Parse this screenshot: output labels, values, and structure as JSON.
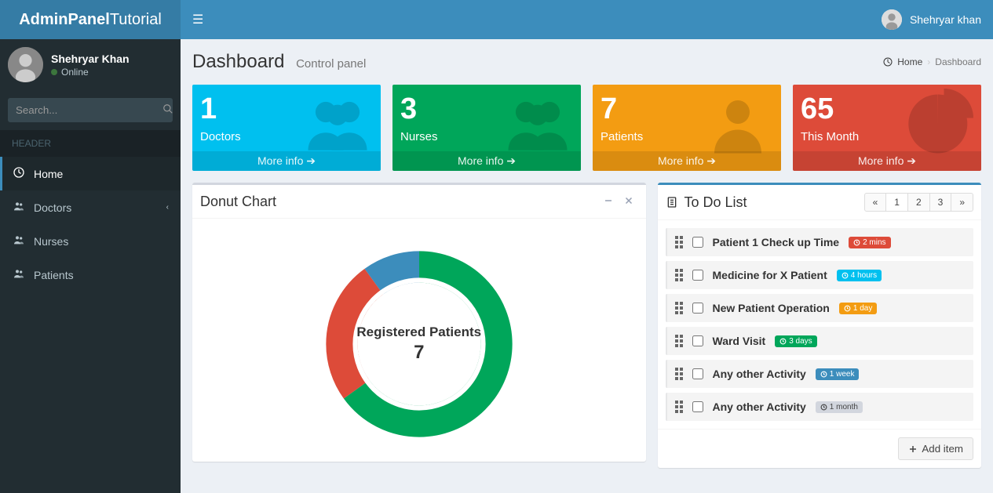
{
  "brand": {
    "bold": "AdminPanel",
    "light": "Tutorial"
  },
  "topbar": {
    "username": "Shehryar khan"
  },
  "sidebar": {
    "user": {
      "name": "Shehryar Khan",
      "status": "Online"
    },
    "search_placeholder": "Search...",
    "header": "HEADER",
    "menu": [
      {
        "label": "Home",
        "icon": "dashboard",
        "active": true
      },
      {
        "label": "Doctors",
        "icon": "users",
        "has_children": true
      },
      {
        "label": "Nurses",
        "icon": "users"
      },
      {
        "label": "Patients",
        "icon": "users"
      }
    ]
  },
  "page": {
    "title": "Dashboard",
    "subtitle": "Control panel",
    "breadcrumb_home": "Home",
    "breadcrumb_current": "Dashboard"
  },
  "stats": [
    {
      "value": "1",
      "label": "Doctors",
      "more": "More info",
      "color": "aqua",
      "icon": "users"
    },
    {
      "value": "3",
      "label": "Nurses",
      "more": "More info",
      "color": "green",
      "icon": "users"
    },
    {
      "value": "7",
      "label": "Patients",
      "more": "More info",
      "color": "yellow",
      "icon": "person"
    },
    {
      "value": "65",
      "label": "This Month",
      "more": "More info",
      "color": "red",
      "icon": "pie"
    }
  ],
  "donut": {
    "title": "Donut Chart",
    "center_label": "Registered Patients",
    "center_value": "7"
  },
  "chart_data": {
    "type": "pie",
    "title": "Registered Patients",
    "center_value": 7,
    "series": [
      {
        "name": "Green segment",
        "value": 65,
        "color": "#00a65a"
      },
      {
        "name": "Red segment",
        "value": 25,
        "color": "#dd4b39"
      },
      {
        "name": "Blue segment",
        "value": 10,
        "color": "#3c8dbc"
      }
    ]
  },
  "todo": {
    "title": "To Do List",
    "pages": [
      "«",
      "1",
      "2",
      "3",
      "»"
    ],
    "add_label": "Add item",
    "items": [
      {
        "text": "Patient 1 Check up Time",
        "badge": "2 mins",
        "badge_color": "red"
      },
      {
        "text": "Medicine for X Patient",
        "badge": "4 hours",
        "badge_color": "aqua"
      },
      {
        "text": "New Patient Operation",
        "badge": "1 day",
        "badge_color": "orange"
      },
      {
        "text": "Ward Visit",
        "badge": "3 days",
        "badge_color": "green"
      },
      {
        "text": "Any other Activity",
        "badge": "1 week",
        "badge_color": "blue"
      },
      {
        "text": "Any other Activity",
        "badge": "1 month",
        "badge_color": "gray"
      }
    ]
  }
}
